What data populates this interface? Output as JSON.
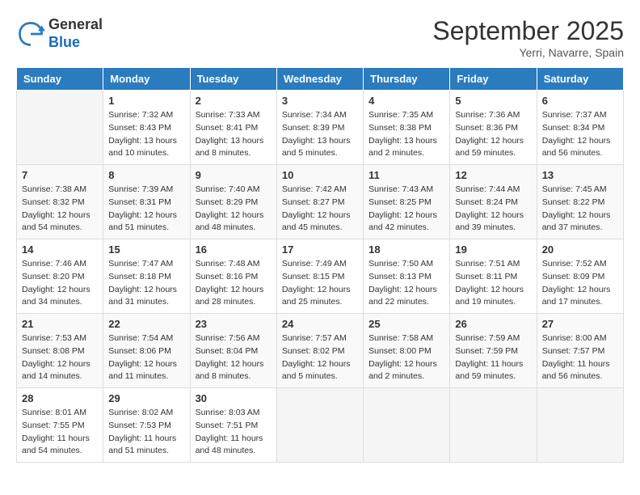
{
  "header": {
    "logo_general": "General",
    "logo_blue": "Blue",
    "month_title": "September 2025",
    "subtitle": "Yerri, Navarre, Spain"
  },
  "days_of_week": [
    "Sunday",
    "Monday",
    "Tuesday",
    "Wednesday",
    "Thursday",
    "Friday",
    "Saturday"
  ],
  "weeks": [
    [
      {
        "day": "",
        "detail": ""
      },
      {
        "day": "1",
        "detail": "Sunrise: 7:32 AM\nSunset: 8:43 PM\nDaylight: 13 hours\nand 10 minutes."
      },
      {
        "day": "2",
        "detail": "Sunrise: 7:33 AM\nSunset: 8:41 PM\nDaylight: 13 hours\nand 8 minutes."
      },
      {
        "day": "3",
        "detail": "Sunrise: 7:34 AM\nSunset: 8:39 PM\nDaylight: 13 hours\nand 5 minutes."
      },
      {
        "day": "4",
        "detail": "Sunrise: 7:35 AM\nSunset: 8:38 PM\nDaylight: 13 hours\nand 2 minutes."
      },
      {
        "day": "5",
        "detail": "Sunrise: 7:36 AM\nSunset: 8:36 PM\nDaylight: 12 hours\nand 59 minutes."
      },
      {
        "day": "6",
        "detail": "Sunrise: 7:37 AM\nSunset: 8:34 PM\nDaylight: 12 hours\nand 56 minutes."
      }
    ],
    [
      {
        "day": "7",
        "detail": "Sunrise: 7:38 AM\nSunset: 8:32 PM\nDaylight: 12 hours\nand 54 minutes."
      },
      {
        "day": "8",
        "detail": "Sunrise: 7:39 AM\nSunset: 8:31 PM\nDaylight: 12 hours\nand 51 minutes."
      },
      {
        "day": "9",
        "detail": "Sunrise: 7:40 AM\nSunset: 8:29 PM\nDaylight: 12 hours\nand 48 minutes."
      },
      {
        "day": "10",
        "detail": "Sunrise: 7:42 AM\nSunset: 8:27 PM\nDaylight: 12 hours\nand 45 minutes."
      },
      {
        "day": "11",
        "detail": "Sunrise: 7:43 AM\nSunset: 8:25 PM\nDaylight: 12 hours\nand 42 minutes."
      },
      {
        "day": "12",
        "detail": "Sunrise: 7:44 AM\nSunset: 8:24 PM\nDaylight: 12 hours\nand 39 minutes."
      },
      {
        "day": "13",
        "detail": "Sunrise: 7:45 AM\nSunset: 8:22 PM\nDaylight: 12 hours\nand 37 minutes."
      }
    ],
    [
      {
        "day": "14",
        "detail": "Sunrise: 7:46 AM\nSunset: 8:20 PM\nDaylight: 12 hours\nand 34 minutes."
      },
      {
        "day": "15",
        "detail": "Sunrise: 7:47 AM\nSunset: 8:18 PM\nDaylight: 12 hours\nand 31 minutes."
      },
      {
        "day": "16",
        "detail": "Sunrise: 7:48 AM\nSunset: 8:16 PM\nDaylight: 12 hours\nand 28 minutes."
      },
      {
        "day": "17",
        "detail": "Sunrise: 7:49 AM\nSunset: 8:15 PM\nDaylight: 12 hours\nand 25 minutes."
      },
      {
        "day": "18",
        "detail": "Sunrise: 7:50 AM\nSunset: 8:13 PM\nDaylight: 12 hours\nand 22 minutes."
      },
      {
        "day": "19",
        "detail": "Sunrise: 7:51 AM\nSunset: 8:11 PM\nDaylight: 12 hours\nand 19 minutes."
      },
      {
        "day": "20",
        "detail": "Sunrise: 7:52 AM\nSunset: 8:09 PM\nDaylight: 12 hours\nand 17 minutes."
      }
    ],
    [
      {
        "day": "21",
        "detail": "Sunrise: 7:53 AM\nSunset: 8:08 PM\nDaylight: 12 hours\nand 14 minutes."
      },
      {
        "day": "22",
        "detail": "Sunrise: 7:54 AM\nSunset: 8:06 PM\nDaylight: 12 hours\nand 11 minutes."
      },
      {
        "day": "23",
        "detail": "Sunrise: 7:56 AM\nSunset: 8:04 PM\nDaylight: 12 hours\nand 8 minutes."
      },
      {
        "day": "24",
        "detail": "Sunrise: 7:57 AM\nSunset: 8:02 PM\nDaylight: 12 hours\nand 5 minutes."
      },
      {
        "day": "25",
        "detail": "Sunrise: 7:58 AM\nSunset: 8:00 PM\nDaylight: 12 hours\nand 2 minutes."
      },
      {
        "day": "26",
        "detail": "Sunrise: 7:59 AM\nSunset: 7:59 PM\nDaylight: 11 hours\nand 59 minutes."
      },
      {
        "day": "27",
        "detail": "Sunrise: 8:00 AM\nSunset: 7:57 PM\nDaylight: 11 hours\nand 56 minutes."
      }
    ],
    [
      {
        "day": "28",
        "detail": "Sunrise: 8:01 AM\nSunset: 7:55 PM\nDaylight: 11 hours\nand 54 minutes."
      },
      {
        "day": "29",
        "detail": "Sunrise: 8:02 AM\nSunset: 7:53 PM\nDaylight: 11 hours\nand 51 minutes."
      },
      {
        "day": "30",
        "detail": "Sunrise: 8:03 AM\nSunset: 7:51 PM\nDaylight: 11 hours\nand 48 minutes."
      },
      {
        "day": "",
        "detail": ""
      },
      {
        "day": "",
        "detail": ""
      },
      {
        "day": "",
        "detail": ""
      },
      {
        "day": "",
        "detail": ""
      }
    ]
  ]
}
